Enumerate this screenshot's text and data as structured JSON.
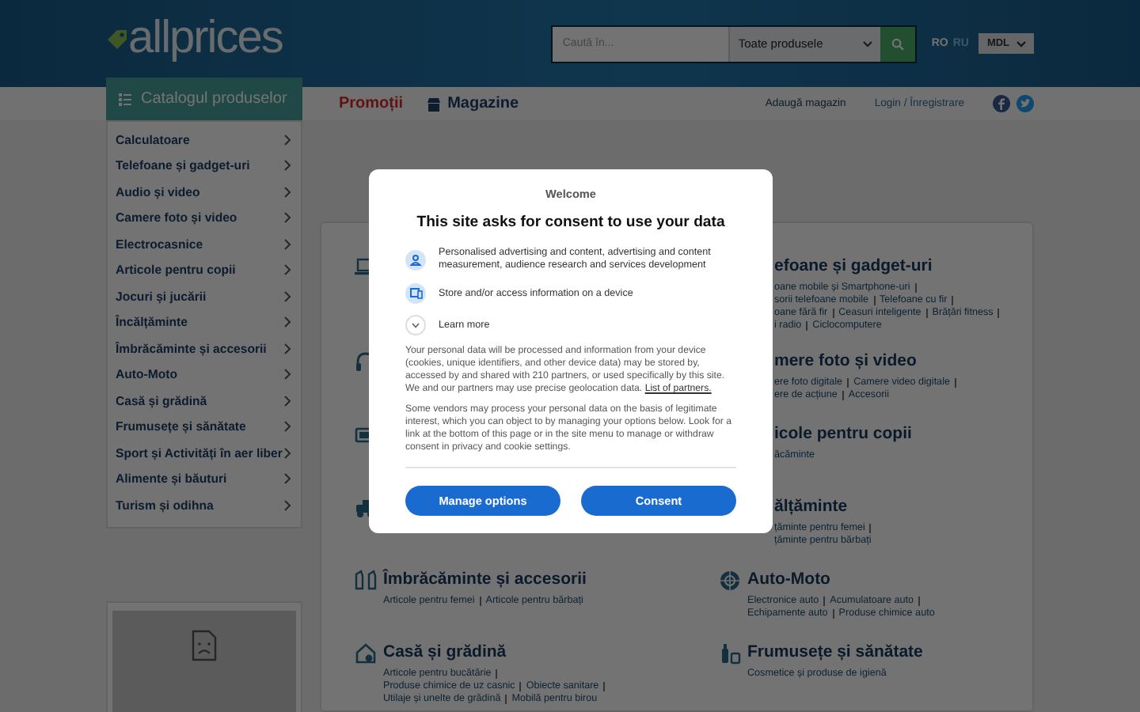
{
  "header": {
    "logo": "allprices",
    "search": {
      "placeholder": "Caută în...",
      "scope": "Toate produsele"
    },
    "languages": [
      {
        "label": "RO",
        "selected": true
      },
      {
        "label": "RU",
        "selected": false
      }
    ],
    "currency": "MDL"
  },
  "nav": {
    "catalog_title": "Catalogul produselor",
    "links": [
      {
        "label": "Promoții",
        "kind": "promo"
      },
      {
        "label": "Magazine",
        "kind": "shops"
      }
    ],
    "account_links": [
      "Adaugă magazin",
      "Login / Înregistrare"
    ]
  },
  "sidebar": {
    "items": [
      "Calculatoare",
      "Telefoane și gadget-uri",
      "Audio și video",
      "Camere foto și video",
      "Electrocasnice",
      "Articole pentru copii",
      "Jocuri și jucării",
      "Încălțăminte",
      "Îmbrăcăminte și accesorii",
      "Auto-Moto",
      "Casă și grădină",
      "Frumusețe și sănătate",
      "Sport și Activități în aer liber",
      "Alimente și băuturi",
      "Turism și odihna"
    ]
  },
  "categories": {
    "left": [
      {
        "kind": "full",
        "title": "Îmbrăcăminte și accesorii",
        "lines": [
          [
            "Articole pentru femei",
            "Articole pentru bărbați"
          ]
        ]
      },
      {
        "kind": "full",
        "title": "Casă și grădină",
        "lines": [
          [
            "Articole pentru bucătărie"
          ],
          [
            "Produse chimice de uz casnic",
            "Obiecte sanitare"
          ],
          [
            "Utilaje și unelte de grădină",
            "Mobilă pentru birou"
          ]
        ]
      }
    ],
    "right": [
      {
        "kind": "partial",
        "title": "efoane și gadget-uri",
        "lines": [
          [
            "oane mobile și Smartphone-uri"
          ],
          [
            "sorii telefoane mobile",
            "Telefoane cu fir"
          ],
          [
            "oane fără fir",
            "Ceasuri inteligente",
            "Brățări fitness"
          ],
          [
            "i radio",
            "Ciclocomputere"
          ]
        ]
      },
      {
        "kind": "partial",
        "title": "mere foto și video",
        "lines": [
          [
            "ere foto digitale",
            "Camere video digitale"
          ],
          [
            "ere de acțiune",
            "Accesorii"
          ]
        ]
      },
      {
        "kind": "partial",
        "title": "icole pentru copii",
        "lines": [
          [
            "ăcăminte"
          ]
        ]
      },
      {
        "kind": "partial",
        "title": "ălțăminte",
        "lines": [
          [
            "țăminte pentru femei"
          ],
          [
            "țăminte pentru bărbați"
          ]
        ]
      },
      {
        "kind": "full",
        "title": "Auto-Moto",
        "lines": [
          [
            "Electronice auto",
            "Acumulatoare auto"
          ],
          [
            "Echipamente auto",
            "Produse chimice auto"
          ]
        ]
      },
      {
        "kind": "full",
        "title": "Frumusețe și sănătate",
        "lines": [
          [
            "Cosmetice și produse de igienă"
          ]
        ]
      }
    ]
  },
  "consent_dialog": {
    "welcome": "Welcome",
    "title": "This site asks for consent to use your data",
    "purposes": [
      {
        "kind": "person",
        "text": "Personalised advertising and content, advertising and content measurement, audience research and services development"
      },
      {
        "kind": "device",
        "text": "Store and/or access information on a device"
      }
    ],
    "learn_more": "Learn more",
    "paragraph_1": "Your personal data will be processed and information from your device (cookies, unique identifiers, and other device data) may be stored by, accessed by and shared with 210 partners, or used specifically by this site. We and our partners may use precise geolocation data.",
    "partners_link": "List of partners.",
    "paragraph_2": "Some vendors may process your personal data on the basis of legitimate interest, which you can object to by managing your options below. Look for a link at the bottom of this page or in the site menu to manage or withdraw consent in privacy and cookie settings.",
    "buttons": [
      "Manage options",
      "Consent"
    ]
  }
}
